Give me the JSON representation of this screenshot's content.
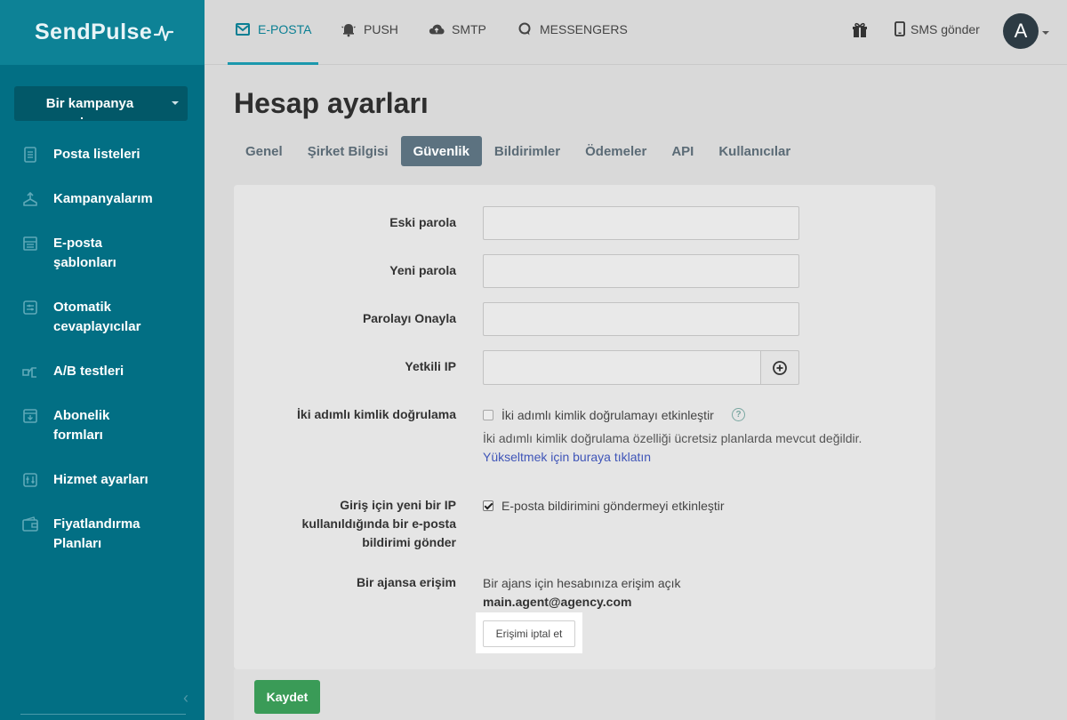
{
  "brand": {
    "name": "SendPulse"
  },
  "topnav": {
    "tabs": [
      {
        "label": "E-POSTA",
        "icon": "mail-icon"
      },
      {
        "label": "PUSH",
        "icon": "bell-icon"
      },
      {
        "label": "SMTP",
        "icon": "cloud-icon"
      },
      {
        "label": "MESSENGERS",
        "icon": "chat-icon"
      }
    ],
    "sms_label": "SMS gönder",
    "avatar_letter": "A"
  },
  "sidebar": {
    "campaign_button": "Bir kampanya",
    "items": [
      {
        "label": "Posta listeleri",
        "icon": "list-icon"
      },
      {
        "label": "Kampanyalarım",
        "icon": "campaign-icon"
      },
      {
        "label": "E-posta şablonları",
        "icon": "template-icon"
      },
      {
        "label": "Otomatik cevaplayıcılar",
        "icon": "autoresponder-icon"
      },
      {
        "label": "A/B testleri",
        "icon": "ab-test-icon"
      },
      {
        "label": "Abonelik formları",
        "icon": "form-icon"
      },
      {
        "label": "Hizmet ayarları",
        "icon": "settings-icon"
      },
      {
        "label": "Fiyatlandırma Planları",
        "icon": "wallet-icon"
      }
    ],
    "collapse_glyph": "‹"
  },
  "page": {
    "title": "Hesap ayarları",
    "tabs": [
      "Genel",
      "Şirket Bilgisi",
      "Güvenlik",
      "Bildirimler",
      "Ödemeler",
      "API",
      "Kullanıcılar"
    ],
    "active_tab": "Güvenlik"
  },
  "form": {
    "old_password": {
      "label": "Eski parola",
      "value": ""
    },
    "new_password": {
      "label": "Yeni parola",
      "value": ""
    },
    "confirm_password": {
      "label": "Parolayı Onayla",
      "value": ""
    },
    "authorized_ip": {
      "label": "Yetkili IP",
      "value": ""
    },
    "two_factor": {
      "label": "İki adımlı kimlik doğrulama",
      "checkbox_label": "İki adımlı kimlik doğrulamayı etkinleştir",
      "checked": false,
      "note": "İki adımlı kimlik doğrulama özelliği ücretsiz planlarda mevcut değildir.",
      "upgrade_link": "Yükseltmek için buraya tıklatın"
    },
    "new_ip_email": {
      "label_lines": [
        "Giriş için yeni bir IP",
        "kullanıldığında bir e-posta",
        "bildirimi gönder"
      ],
      "checkbox_label": "E-posta bildirimini göndermeyi etkinleştir",
      "checked": true
    },
    "agency_access": {
      "label": "Bir ajansa erişim",
      "status": "Bir ajans için hesabınıza erişim açık",
      "email": "main.agent@agency.com",
      "revoke_button": "Erişimi iptal et"
    },
    "save_button": "Kaydet"
  },
  "colors": {
    "sidebar": "#026f84",
    "accent": "#1b98ad",
    "save": "#3a9b57",
    "active_tab": "#5c7280",
    "link": "#3f55b8"
  }
}
